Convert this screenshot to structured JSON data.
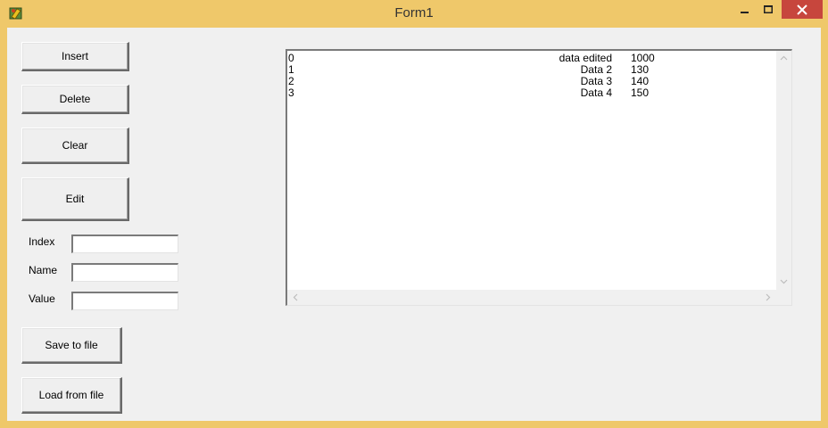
{
  "window": {
    "title": "Form1",
    "app_icon": "delphi-app-icon",
    "frame_color": "#efc86a",
    "close_color": "#c7463d"
  },
  "buttons": {
    "insert": "Insert",
    "delete": "Delete",
    "clear": "Clear",
    "edit": "Edit",
    "save_to_file": "Save to file",
    "load_from_file": "Load from file"
  },
  "fields": {
    "index_label": "Index",
    "index_value": "",
    "name_label": "Name",
    "name_value": "",
    "value_label": "Value",
    "value_value": ""
  },
  "list": {
    "rows": [
      {
        "index": "0",
        "name": "data edited",
        "value": "1000"
      },
      {
        "index": "1",
        "name": "Data 2",
        "value": "130"
      },
      {
        "index": "2",
        "name": "Data 3",
        "value": "140"
      },
      {
        "index": "3",
        "name": "Data 4",
        "value": "150"
      }
    ]
  }
}
